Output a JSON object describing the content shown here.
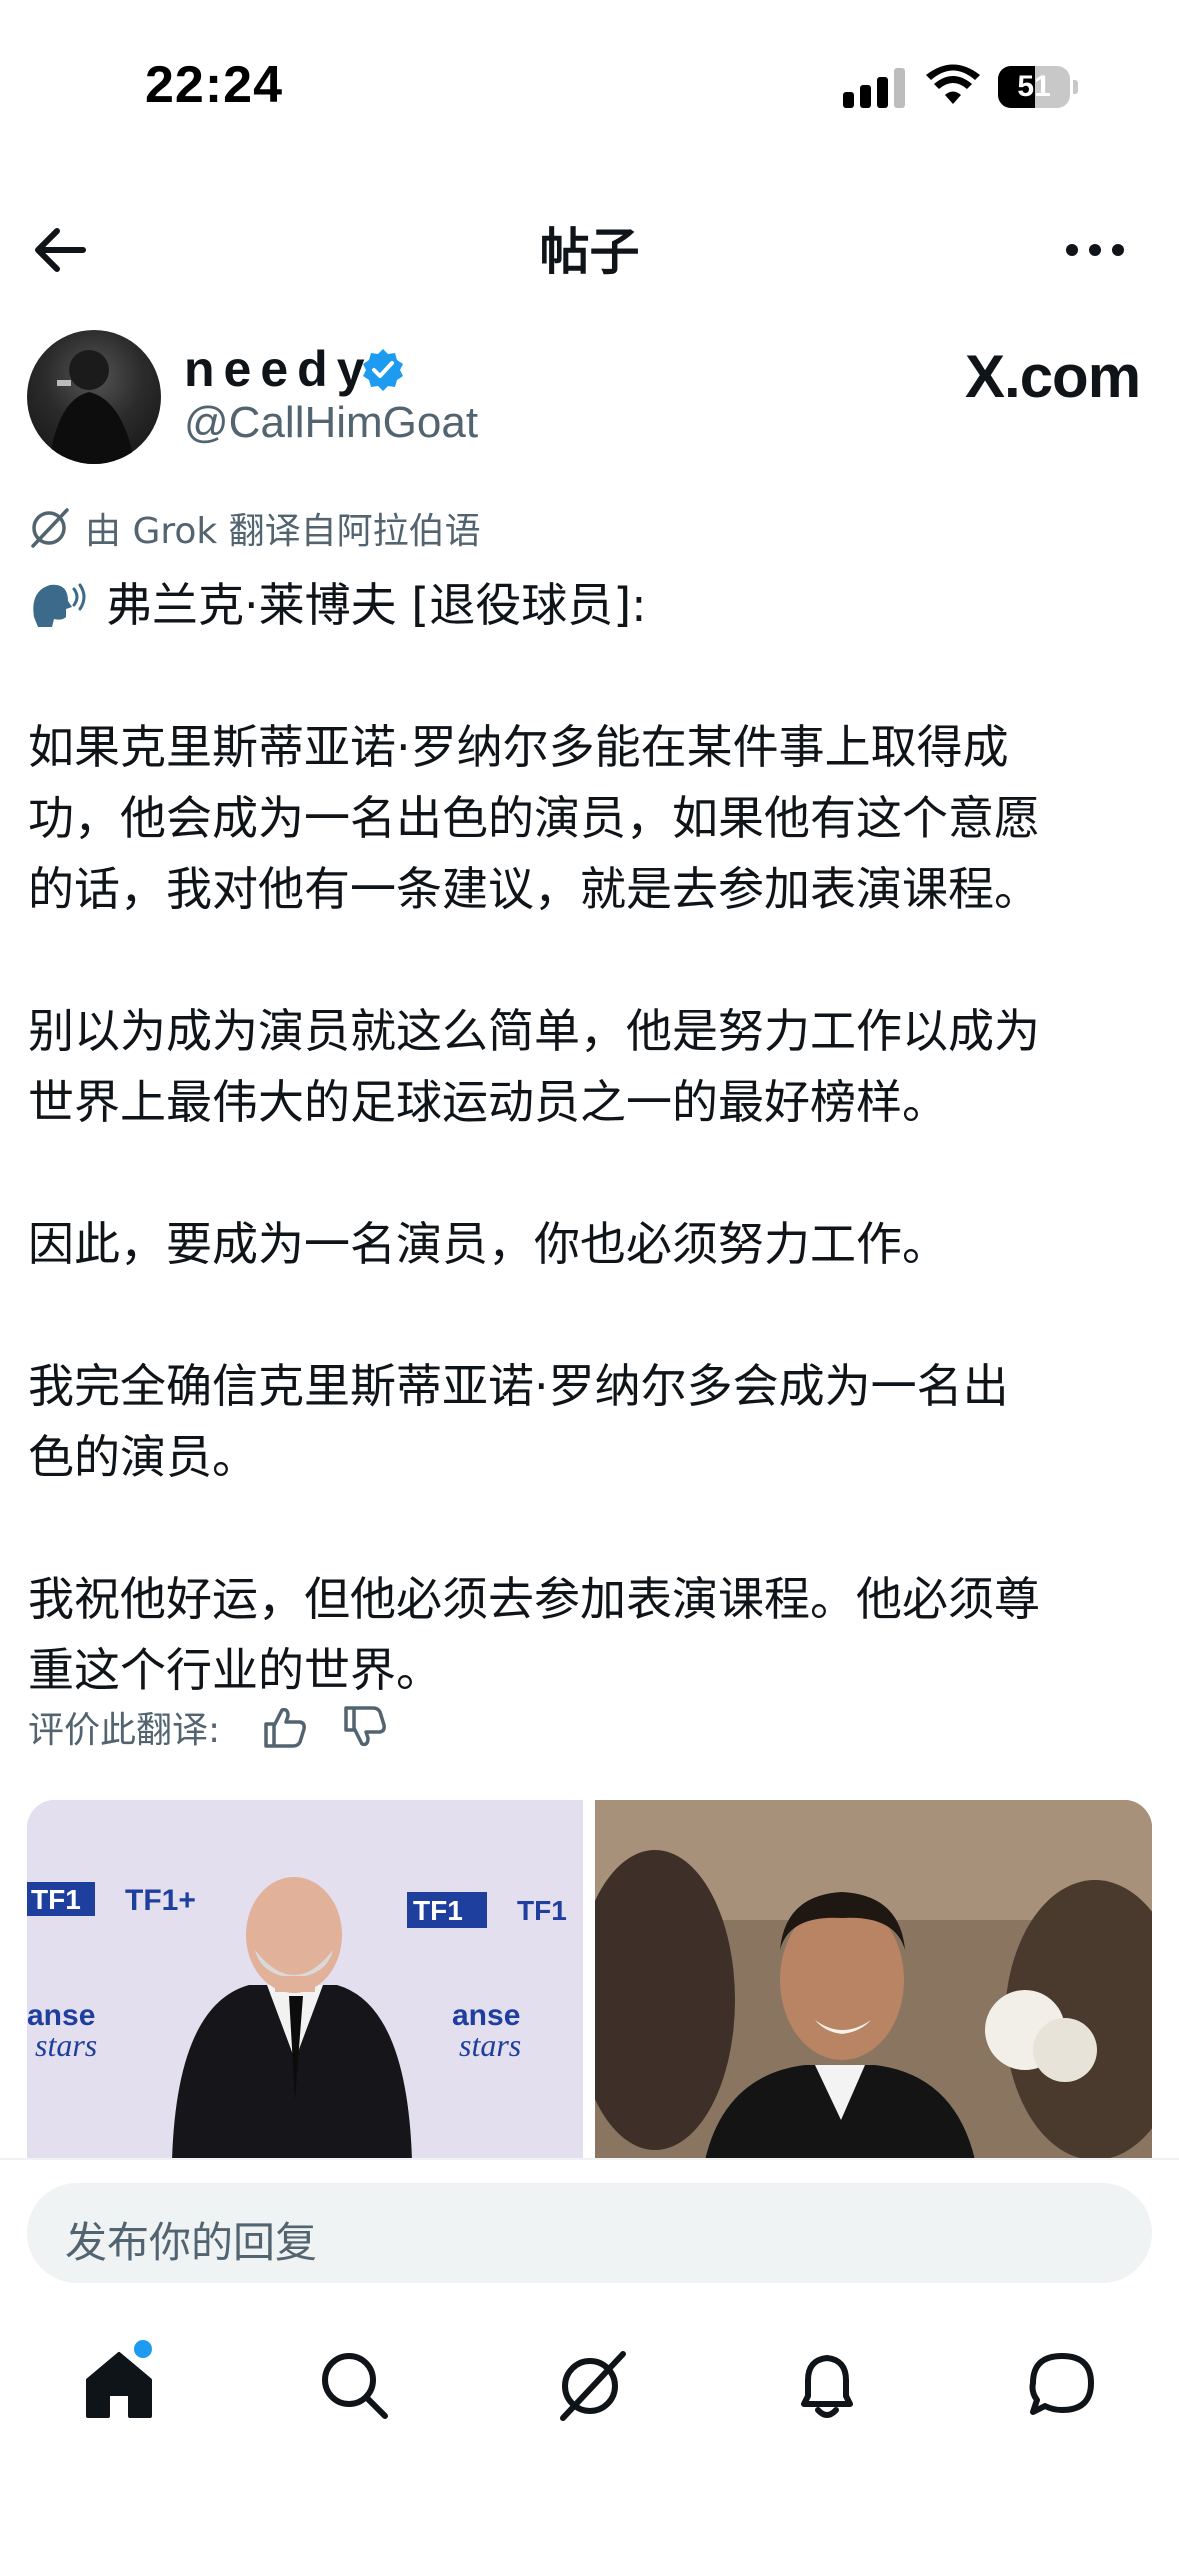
{
  "status_bar": {
    "time": "22:24",
    "battery_percent": "51",
    "battery_level": 0.51
  },
  "header": {
    "title": "帖子",
    "back_icon": "arrow-left-icon",
    "more_icon": "more-horizontal-icon"
  },
  "author": {
    "display_name": "needy",
    "handle": "@CallHimGoat",
    "verified": true,
    "badge_color": "#1d9bf0",
    "watermark": "X.com"
  },
  "translation_note": "由 Grok 翻译自阿拉伯语",
  "post": {
    "headline": "弗兰克·莱博夫 [退役球员]:",
    "paragraphs": [
      [
        "如果克里斯蒂亚诺·罗纳尔多能在某件事上取得成",
        "功，他会成为一名出色的演员，如果他有这个意愿",
        "的话，我对他有一条建议，就是去参加表演课程。"
      ],
      [
        "别以为成为演员就这么简单，他是努力工作以成为",
        "世界上最伟大的足球运动员之一的最好榜样。"
      ],
      [
        "因此，要成为一名演员，你也必须努力工作。"
      ],
      [
        "我完全确信克里斯蒂亚诺·罗纳尔多会成为一名出",
        "色的演员。"
      ],
      [
        "我祝他好运，但他必须去参加表演课程。他必须尊",
        "重这个行业的世界。"
      ]
    ]
  },
  "rate": {
    "label": "评价此翻译:"
  },
  "media": {
    "left_backdrop_texts": [
      "TF1",
      "TF1+",
      "TF1",
      "TF1",
      "anse",
      "stars",
      "anse",
      "stars"
    ]
  },
  "reply": {
    "placeholder": "发布你的回复"
  },
  "tabs": [
    {
      "name": "home",
      "icon": "home-icon",
      "active": true,
      "has_notification_dot": true
    },
    {
      "name": "search",
      "icon": "search-icon"
    },
    {
      "name": "grok",
      "icon": "grok-icon"
    },
    {
      "name": "notifications",
      "icon": "bell-icon"
    },
    {
      "name": "messages",
      "icon": "message-icon"
    }
  ],
  "colors": {
    "text_primary": "#0f1419",
    "text_secondary": "#536471",
    "accent": "#1d9bf0",
    "surface": "#eff3f4"
  }
}
